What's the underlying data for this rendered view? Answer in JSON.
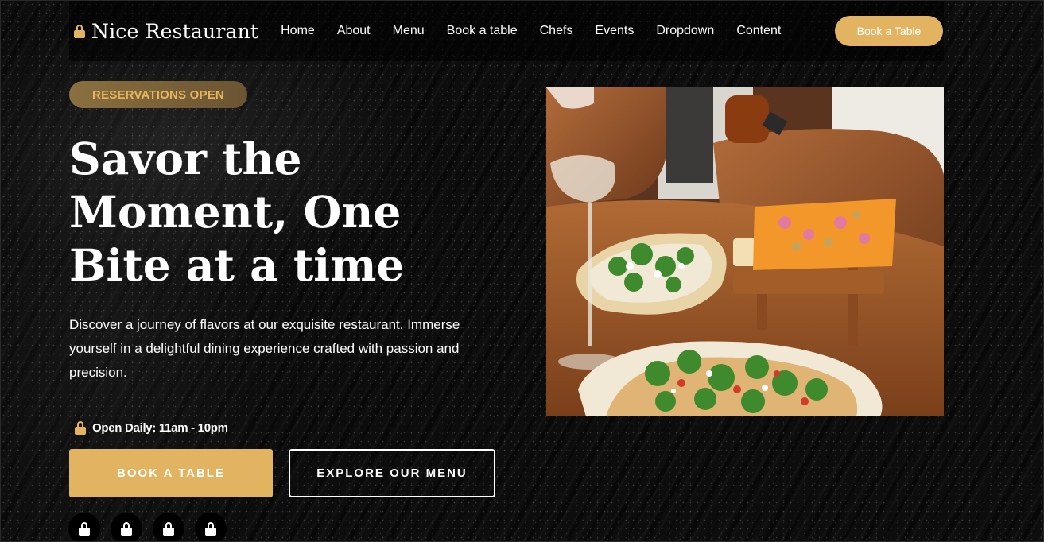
{
  "brand": {
    "name": "Nice Restaurant",
    "icon": "lock-icon",
    "accent": "#e2b461"
  },
  "nav": {
    "items": [
      "Home",
      "About",
      "Menu",
      "Book a table",
      "Chefs",
      "Events",
      "Dropdown",
      "Content"
    ],
    "cta_label": "Book a Table"
  },
  "hero": {
    "badge": "RESERVATIONS OPEN",
    "headline": "Savor the Moment, One Bite at a time",
    "description": "Discover a journey of flavors at our exquisite restaurant. Immerse yourself in a delightful dining experience crafted with passion and precision.",
    "hours": "Open Daily: 11am - 10pm",
    "primary_button": "BOOK A TABLE",
    "secondary_button": "EXPLORE OUR MENU",
    "social_icons": [
      "lock-icon",
      "lock-icon",
      "lock-icon",
      "lock-icon"
    ],
    "image_subject": "food-photo"
  }
}
